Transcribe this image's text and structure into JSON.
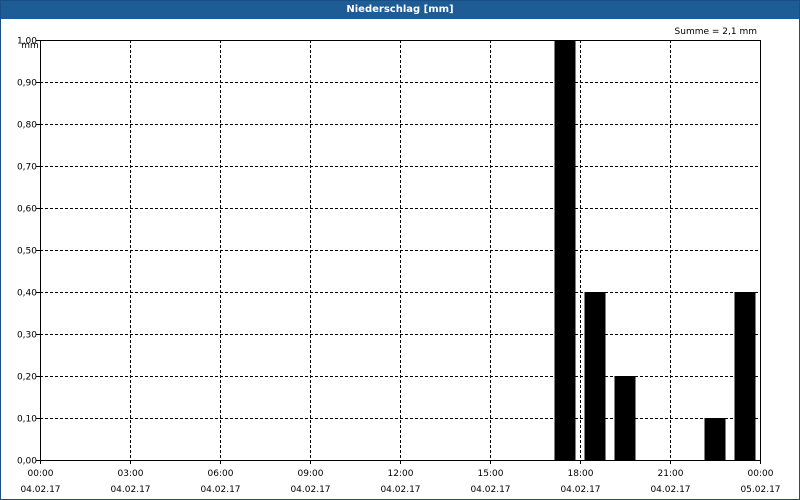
{
  "window": {
    "title": "Niederschlag [mm]"
  },
  "summary": "Summe = 2,1 mm",
  "chart_data": {
    "type": "bar",
    "title": "Niederschlag [mm]",
    "ylabel": "mm",
    "xlabel": "",
    "ylim": [
      0,
      1.0
    ],
    "yticks": [
      "0,00",
      "0,10",
      "0,20",
      "0,30",
      "0,40",
      "0,50",
      "0,60",
      "0,70",
      "0,80",
      "0,90",
      "1,00"
    ],
    "xticks": [
      {
        "time": "00:00",
        "date": "04.02.17"
      },
      {
        "time": "03:00",
        "date": "04.02.17"
      },
      {
        "time": "06:00",
        "date": "04.02.17"
      },
      {
        "time": "09:00",
        "date": "04.02.17"
      },
      {
        "time": "12:00",
        "date": "04.02.17"
      },
      {
        "time": "15:00",
        "date": "04.02.17"
      },
      {
        "time": "18:00",
        "date": "04.02.17"
      },
      {
        "time": "21:00",
        "date": "04.02.17"
      },
      {
        "time": "00:00",
        "date": "05.02.17"
      }
    ],
    "bars": [
      {
        "time": "17:30",
        "value": 1.0
      },
      {
        "time": "18:30",
        "value": 0.4
      },
      {
        "time": "19:30",
        "value": 0.2
      },
      {
        "time": "22:30",
        "value": 0.1
      },
      {
        "time": "23:30",
        "value": 0.4
      }
    ],
    "grid": true,
    "bar_color": "#000000"
  }
}
